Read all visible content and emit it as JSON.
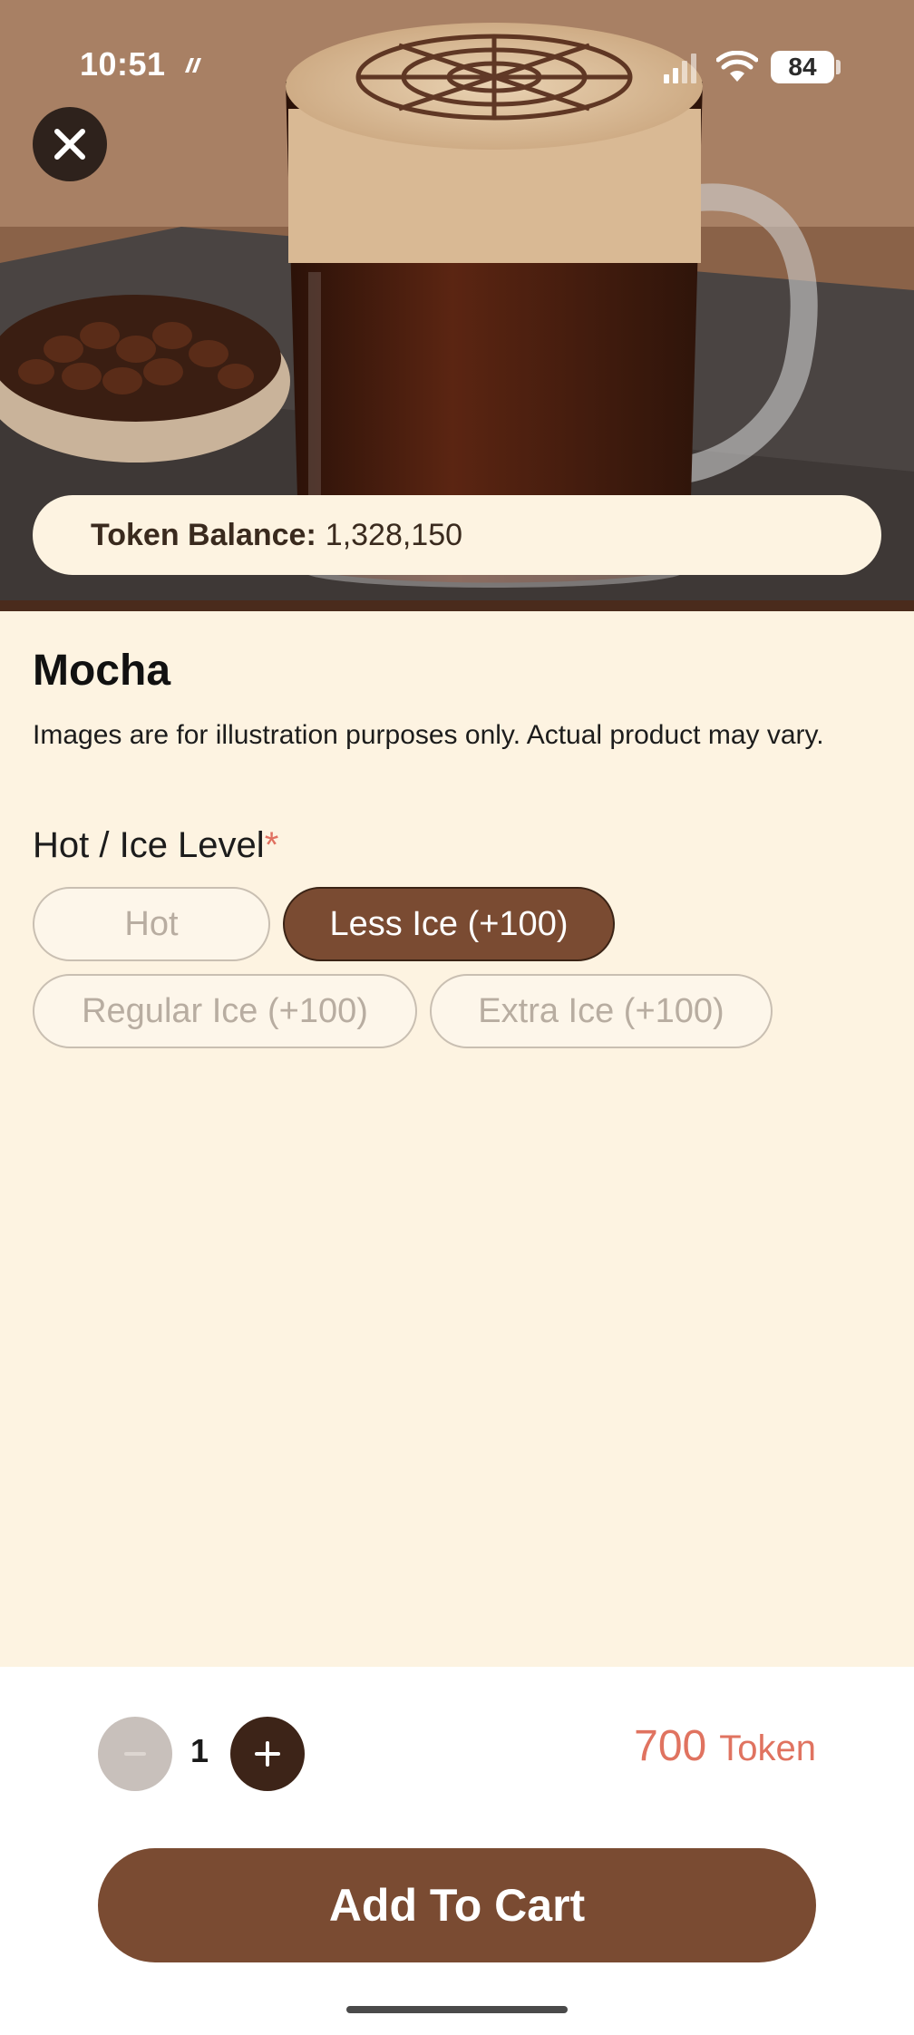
{
  "status_bar": {
    "time": "10:51",
    "battery": "84",
    "icons": [
      "notification-icon",
      "signal-icon",
      "wifi-icon",
      "battery-icon"
    ]
  },
  "close_icon": "close-icon",
  "token_balance": {
    "label": "Token Balance:",
    "value": "1,328,150"
  },
  "product": {
    "name": "Mocha",
    "disclaimer": "Images are for illustration purposes only. Actual product may vary."
  },
  "option_group": {
    "heading": "Hot / Ice Level",
    "required_marker": "*",
    "options": [
      {
        "label": "Hot",
        "selected": false
      },
      {
        "label": "Less Ice (+100)",
        "selected": true
      },
      {
        "label": "Regular Ice (+100)",
        "selected": false
      },
      {
        "label": "Extra Ice (+100)",
        "selected": false
      }
    ]
  },
  "quantity": {
    "value": "1",
    "minus_icon": "minus-icon",
    "plus_icon": "plus-icon"
  },
  "price": {
    "amount": "700",
    "unit": "Token"
  },
  "add_to_cart_label": "Add To Cart",
  "colors": {
    "background": "#fdf3e1",
    "accent_brown": "#7a4b32",
    "dark_brown": "#3d2418",
    "price_red": "#e07360"
  }
}
